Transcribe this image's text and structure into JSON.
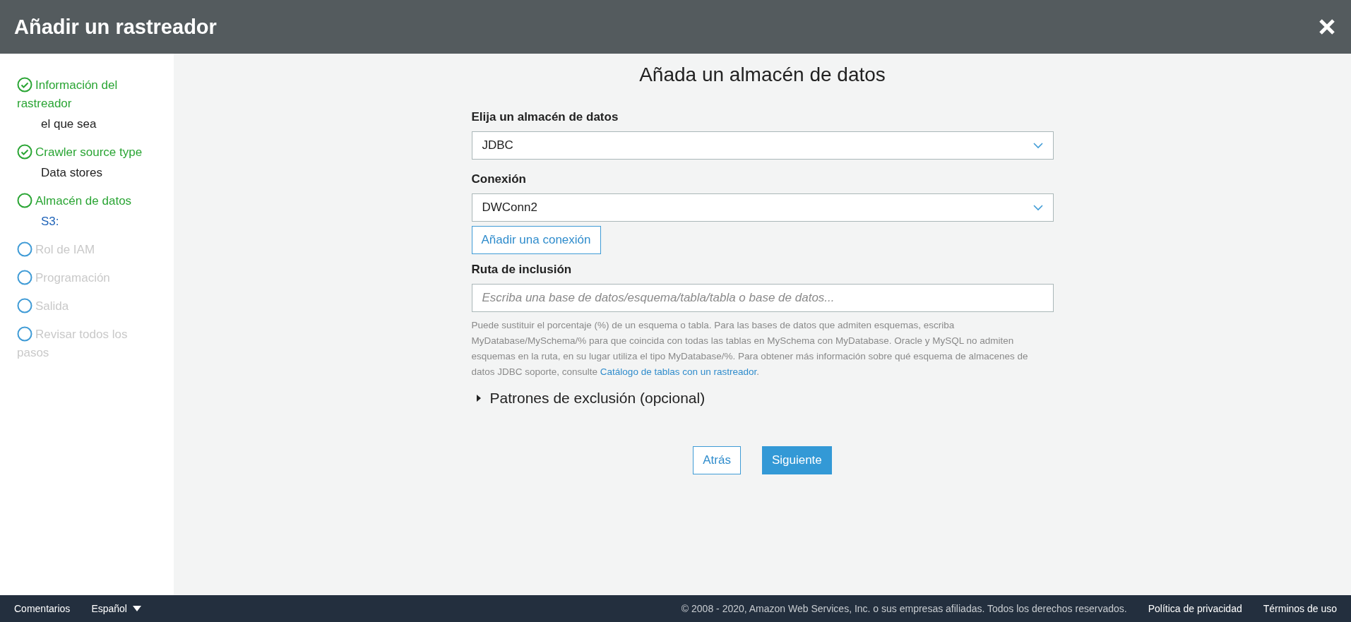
{
  "window": {
    "title": "Añadir un rastreador"
  },
  "steps": [
    {
      "label": "Información del rastreador",
      "checked": true,
      "disabled": false,
      "detail": {
        "text": "el que sea",
        "kind": "plain"
      }
    },
    {
      "label": "Crawler source type",
      "checked": true,
      "disabled": false,
      "detail": {
        "text": "Data stores",
        "kind": "plain"
      }
    },
    {
      "label": "Almacén de datos",
      "checked": false,
      "disabled": false,
      "detail": {
        "text": "S3:",
        "kind": "link"
      }
    },
    {
      "label": "Rol de IAM",
      "checked": false,
      "disabled": true
    },
    {
      "label": "Programación",
      "checked": false,
      "disabled": true
    },
    {
      "label": "Salida",
      "checked": false,
      "disabled": true
    },
    {
      "label": "Revisar todos los pasos",
      "checked": false,
      "disabled": true
    }
  ],
  "form": {
    "title": "Añada un almacén de datos",
    "store": {
      "label": "Elija un almacén de datos",
      "value": "JDBC"
    },
    "connection": {
      "label": "Conexión",
      "value": "DWConn2"
    },
    "add_connection_button": "Añadir una conexión",
    "include_path": {
      "label": "Ruta de inclusión",
      "placeholder": "Escriba una base de datos/esquema/tabla/tabla o base de datos..."
    },
    "help": {
      "text": "Puede sustituir el porcentaje (%) de un esquema o tabla. Para las bases de datos que admiten esquemas, escriba MyDatabase/MySchema/% para que coincida con todas las tablas en MySchema con MyDatabase. Oracle y MySQL no admiten esquemas en la ruta, en su lugar utiliza el tipo MyDatabase/%. Para obtener más información sobre qué esquema de almacenes de datos JDBC soporte, consulte ",
      "link": "Catálogo de tablas con un rastreador",
      "after": "."
    },
    "exclusion": {
      "label": "Patrones de exclusión (opcional)",
      "expanded": false
    },
    "buttons": {
      "back": "Atrás",
      "next": "Siguiente"
    }
  },
  "footer": {
    "feedback": "Comentarios",
    "language": "Español",
    "copyright": "© 2008 - 2020, Amazon Web Services, Inc. o sus empresas afiliadas. Todos los derechos reservados.",
    "privacy": "Política de privacidad",
    "terms": "Términos de uso"
  }
}
